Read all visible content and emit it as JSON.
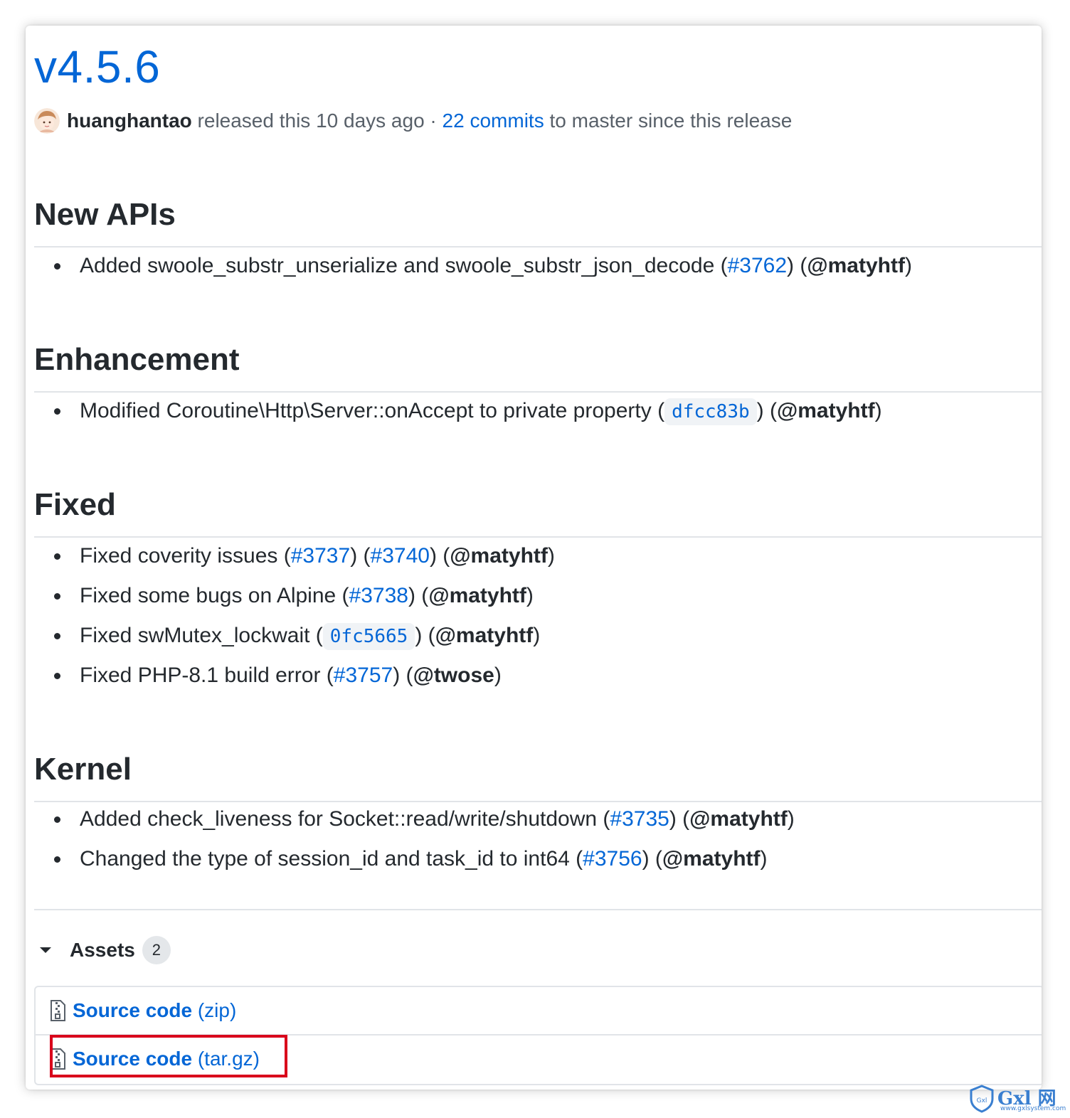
{
  "release": {
    "title": "v4.5.6",
    "author": "huanghantao",
    "released_text": "released this 10 days ago ·",
    "commits_link": "22 commits",
    "commits_suffix": "to master since this release"
  },
  "sections": {
    "new_apis": {
      "heading": "New APIs",
      "items": [
        {
          "text": "Added swoole_substr_unserialize and swoole_substr_json_decode (",
          "link1": "#3762",
          "mid": ") (",
          "user": "@matyhtf",
          "end": ")"
        }
      ]
    },
    "enhancement": {
      "heading": "Enhancement",
      "items": [
        {
          "text": "Modified Coroutine\\Http\\Server::onAccept to private property (",
          "commit": "dfcc83b",
          "mid": ") (",
          "user": "@matyhtf",
          "end": ")"
        }
      ]
    },
    "fixed": {
      "heading": "Fixed",
      "items": [
        {
          "text": "Fixed coverity issues (",
          "link1": "#3737",
          "mid1": ") (",
          "link2": "#3740",
          "mid": ") (",
          "user": "@matyhtf",
          "end": ")"
        },
        {
          "text": "Fixed some bugs on Alpine (",
          "link1": "#3738",
          "mid": ") (",
          "user": "@matyhtf",
          "end": ")"
        },
        {
          "text": "Fixed swMutex_lockwait (",
          "commit": "0fc5665",
          "mid": ") (",
          "user": "@matyhtf",
          "end": ")"
        },
        {
          "text": "Fixed PHP-8.1 build error (",
          "link1": "#3757",
          "mid": ") (",
          "user": "@twose",
          "end": ")"
        }
      ]
    },
    "kernel": {
      "heading": "Kernel",
      "items": [
        {
          "text": "Added check_liveness for Socket::read/write/shutdown (",
          "link1": "#3735",
          "mid": ") (",
          "user": "@matyhtf",
          "end": ")"
        },
        {
          "text": "Changed the type of session_id and task_id to int64 (",
          "link1": "#3756",
          "mid": ") (",
          "user": "@matyhtf",
          "end": ")"
        }
      ]
    }
  },
  "assets": {
    "label": "Assets",
    "count": "2",
    "files": [
      {
        "name": "Source code",
        "ext": "(zip)"
      },
      {
        "name": "Source code",
        "ext": "(tar.gz)"
      }
    ]
  },
  "watermark": {
    "brand": "Gxl 网",
    "sub": "www.gxlsystem.com",
    "shield_text": "Gxl"
  },
  "colors": {
    "link": "#0366d6",
    "text": "#24292e",
    "muted": "#586069",
    "highlight_box": "#d9001b"
  },
  "icons": {
    "author_avatar": "avatar",
    "assets_toggle": "triangle-down-icon",
    "asset_file": "file-zip-icon",
    "watermark": "shield-icon"
  }
}
